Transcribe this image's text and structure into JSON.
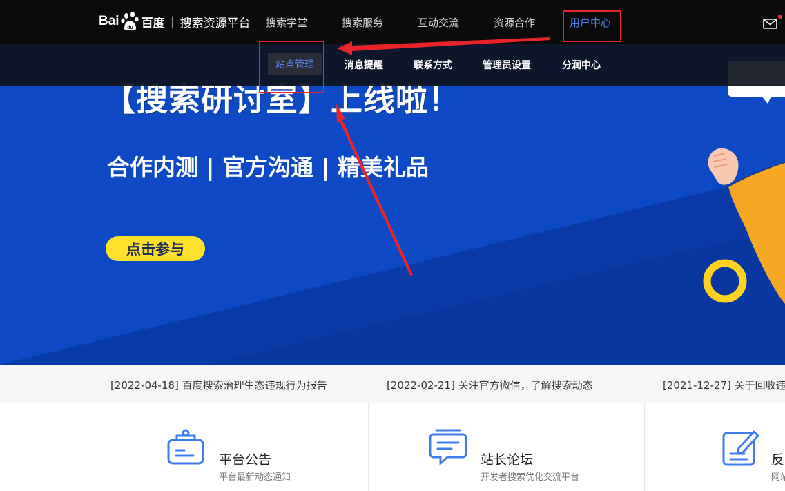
{
  "header": {
    "logo": {
      "bai": "Bai",
      "baidu": "百度",
      "platform": "搜索资源平台"
    },
    "nav": [
      "搜索学堂",
      "搜索服务",
      "互动交流",
      "资源合作",
      "用户中心"
    ],
    "active_nav": "用户中心"
  },
  "subnav": {
    "items": [
      "站点管理",
      "消息提醒",
      "联系方式",
      "管理员设置",
      "分润中心"
    ],
    "active_item": "站点管理"
  },
  "hero": {
    "title": "【搜索研讨室】上线啦！",
    "subtitle": "合作内测 | 官方沟通 | 精美礼品",
    "cta": "点击参与"
  },
  "news": [
    "[2022-04-18] 百度搜索治理生态违规行为报告",
    "[2022-02-21] 关注官方微信，了解搜索动态",
    "[2021-12-27] 关于回收违"
  ],
  "cards": [
    {
      "icon": "announcement-board-icon",
      "title": "平台公告",
      "desc": "平台最新动态通知"
    },
    {
      "icon": "chat-bubble-icon",
      "title": "站长论坛",
      "desc": "开发者搜索优化交流平台"
    },
    {
      "icon": "edit-feedback-icon",
      "title": "反",
      "desc": "网站"
    }
  ],
  "colors": {
    "nav_bg": "#0b0b0b",
    "hero_blue": "#0d49c4",
    "accent_blue": "#4f7ff0",
    "cta_yellow": "#ffe02b",
    "annotation_red": "#e8262a"
  }
}
